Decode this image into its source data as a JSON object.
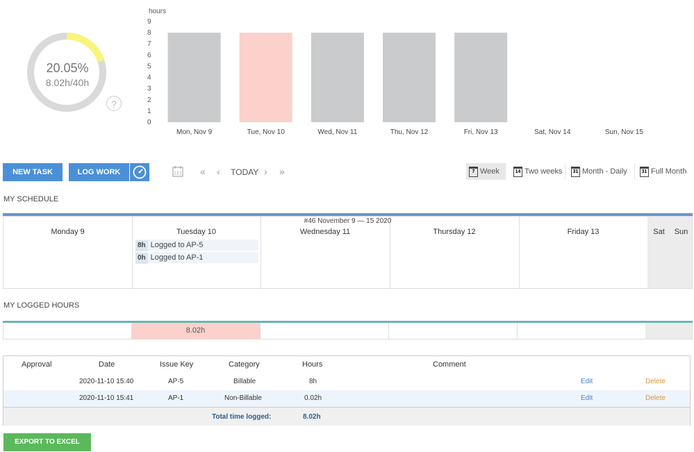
{
  "donut": {
    "percent_text": "20.05%",
    "hours_text": "8.02h/40h",
    "fraction": 0.2005,
    "track_color": "#d9d9d9",
    "fill_color": "#f8f57a",
    "help_symbol": "?"
  },
  "chart_data": {
    "type": "bar",
    "ylabel": "hours",
    "ylim": [
      0,
      9
    ],
    "yticks": [
      0,
      1,
      2,
      3,
      4,
      5,
      6,
      7,
      8,
      9
    ],
    "categories": [
      "Mon, Nov 9",
      "Tue, Nov 10",
      "Wed, Nov 11",
      "Thu, Nov 12",
      "Fri, Nov 13",
      "Sat, Nov 14",
      "Sun, Nov 15"
    ],
    "values": [
      8,
      8,
      8,
      8,
      8,
      0,
      0
    ],
    "bar_colors": [
      "#cacbcd",
      "#fcd0cb",
      "#cacbcd",
      "#cacbcd",
      "#cacbcd",
      "#cacbcd",
      "#cacbcd"
    ]
  },
  "toolbar": {
    "new_task": "NEW TASK",
    "log_work": "LOG WORK",
    "today": "TODAY",
    "nav_first": "«",
    "nav_prev": "‹",
    "nav_next": "›",
    "nav_last": "»"
  },
  "views": [
    {
      "label": "Week",
      "glyph": "7",
      "active": true
    },
    {
      "label": "Two weeks",
      "glyph": "14",
      "active": false
    },
    {
      "label": "Month - Daily",
      "glyph": "31",
      "active": false
    },
    {
      "label": "Full Month",
      "glyph": "31",
      "active": false
    }
  ],
  "schedule": {
    "title": "MY SCHEDULE",
    "week_label": "#46 November 9 — 15 2020",
    "days": [
      "Monday 9",
      "Tuesday 10",
      "Wednesday 11",
      "Thursday 12",
      "Friday 13",
      "Sat",
      "Sun"
    ],
    "entries": [
      {
        "hours": "8h",
        "text": "Logged to AP-5"
      },
      {
        "hours": "0h",
        "text": "Logged to AP-1"
      }
    ]
  },
  "logged": {
    "title": "MY LOGGED HOURS",
    "tuesday_total": "8.02h"
  },
  "table": {
    "headers": [
      "Approval",
      "Date",
      "Issue Key",
      "Category",
      "Hours",
      "Comment"
    ],
    "rows": [
      {
        "approval": "",
        "date": "2020-11-10 15:40",
        "key": "AP-5",
        "category": "Billable",
        "hours": "8h",
        "comment": "",
        "edit": "Edit",
        "delete": "Delete"
      },
      {
        "approval": "",
        "date": "2020-11-10 15:41",
        "key": "AP-1",
        "category": "Non-Billable",
        "hours": "0.02h",
        "comment": "",
        "edit": "Edit",
        "delete": "Delete"
      }
    ],
    "total_label": "Total time logged:",
    "total_value": "8.02h"
  },
  "export_label": "EXPORT TO EXCEL"
}
